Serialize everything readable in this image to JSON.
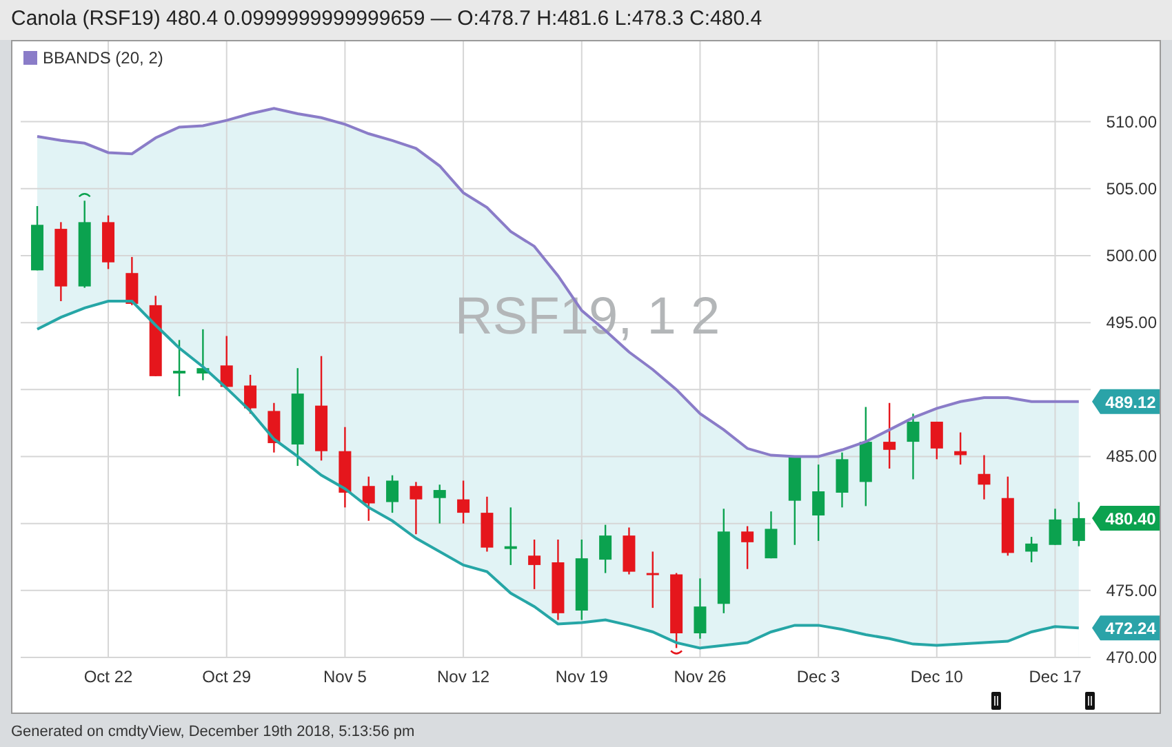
{
  "header": {
    "title": "Canola (RSF19) 480.4 0.0999999999999659 — O:478.7 H:481.6 L:478.3 C:480.4"
  },
  "legend": {
    "color": "#8a7cc8"
  },
  "chart": {
    "symbol_label": "RSF19, 1 2",
    "chart_data": {
      "type": "candlestick",
      "grid": true,
      "ylim": [
        470,
        516
      ],
      "categories": [
        null,
        null,
        null,
        "Oct 22",
        null,
        null,
        null,
        null,
        "Oct 29",
        null,
        null,
        null,
        null,
        "Nov 5",
        null,
        null,
        null,
        null,
        "Nov 12",
        null,
        null,
        null,
        null,
        "Nov 19",
        null,
        null,
        null,
        null,
        "Nov 26",
        null,
        null,
        null,
        null,
        "Dec 3",
        null,
        null,
        null,
        null,
        "Dec 10",
        null,
        null,
        null,
        null,
        "Dec 17",
        null
      ],
      "yticks": [
        {
          "value": 470,
          "label": "470.00"
        },
        {
          "value": 475,
          "label": "475.00"
        },
        {
          "value": 485,
          "label": "485.00"
        },
        {
          "value": 495,
          "label": "495.00"
        },
        {
          "value": 500,
          "label": "500.00"
        },
        {
          "value": 505,
          "label": "505.00"
        },
        {
          "value": 510,
          "label": "510.00"
        }
      ],
      "ohlc": [
        [
          498.9,
          503.7,
          498.9,
          502.3
        ],
        [
          502.0,
          502.5,
          496.6,
          497.7
        ],
        [
          497.7,
          504.1,
          497.6,
          502.5
        ],
        [
          502.5,
          503.0,
          499.0,
          499.5
        ],
        [
          498.7,
          499.9,
          496.3,
          496.4
        ],
        [
          496.3,
          497.0,
          491.0,
          491.0
        ],
        [
          491.2,
          493.7,
          489.5,
          491.4
        ],
        [
          491.2,
          494.5,
          490.7,
          491.6
        ],
        [
          491.8,
          494.0,
          490.0,
          490.2
        ],
        [
          490.3,
          491.1,
          488.2,
          488.6
        ],
        [
          488.4,
          489.0,
          485.3,
          486.0
        ],
        [
          485.9,
          491.6,
          484.3,
          489.7
        ],
        [
          488.8,
          492.5,
          484.7,
          485.4
        ],
        [
          485.4,
          487.2,
          481.2,
          482.3
        ],
        [
          482.8,
          483.5,
          480.2,
          481.5
        ],
        [
          481.6,
          483.6,
          480.8,
          483.2
        ],
        [
          482.8,
          483.1,
          479.2,
          481.8
        ],
        [
          481.9,
          482.9,
          480.0,
          482.5
        ],
        [
          481.8,
          483.2,
          480.0,
          480.8
        ],
        [
          480.8,
          482.0,
          477.9,
          478.2
        ],
        [
          478.1,
          481.2,
          476.9,
          478.3
        ],
        [
          477.6,
          478.8,
          475.1,
          476.9
        ],
        [
          477.1,
          478.8,
          472.8,
          473.3
        ],
        [
          473.5,
          478.8,
          472.8,
          477.4
        ],
        [
          477.3,
          479.9,
          476.3,
          479.1
        ],
        [
          479.1,
          479.7,
          476.2,
          476.4
        ],
        [
          476.3,
          477.9,
          473.7,
          476.2
        ],
        [
          476.2,
          476.3,
          470.7,
          471.8
        ],
        [
          471.8,
          475.9,
          471.4,
          473.8
        ],
        [
          474.0,
          481.1,
          473.3,
          479.4
        ],
        [
          479.4,
          479.8,
          476.6,
          478.6
        ],
        [
          477.4,
          480.9,
          477.4,
          479.6
        ],
        [
          481.7,
          485.0,
          478.4,
          485.0
        ],
        [
          480.6,
          484.4,
          478.7,
          482.4
        ],
        [
          482.3,
          485.3,
          481.2,
          484.8
        ],
        [
          483.1,
          488.7,
          481.3,
          486.1
        ],
        [
          486.1,
          489.0,
          484.1,
          485.5
        ],
        [
          486.1,
          488.2,
          483.3,
          487.6
        ],
        [
          487.6,
          487.6,
          484.8,
          485.6
        ],
        [
          485.4,
          486.8,
          484.4,
          485.1
        ],
        [
          483.7,
          485.1,
          481.8,
          482.9
        ],
        [
          481.9,
          483.5,
          477.6,
          477.8
        ],
        [
          477.9,
          479.0,
          477.1,
          478.5
        ],
        [
          478.4,
          481.1,
          478.4,
          480.3
        ],
        [
          478.7,
          481.6,
          478.3,
          480.4
        ]
      ],
      "series": [
        {
          "name": "BBANDS (20, 2)",
          "type": "area",
          "color": "#8a7cc8",
          "values": [
            508.9,
            508.6,
            508.4,
            507.7,
            507.6,
            508.8,
            509.6,
            509.7,
            510.1,
            510.6,
            511.0,
            510.6,
            510.3,
            509.8,
            509.1,
            508.6,
            508.0,
            506.7,
            504.7,
            503.6,
            501.8,
            500.7,
            498.5,
            495.9,
            494.4,
            492.8,
            491.5,
            490.0,
            488.2,
            487.0,
            485.6,
            485.1,
            485.0,
            485.0,
            485.5,
            486.1,
            487.0,
            487.9,
            488.6,
            489.1,
            489.4,
            489.4,
            489.1,
            489.1,
            489.1
          ]
        },
        {
          "type": "area",
          "color": "#26a6a6",
          "values": [
            494.5,
            495.4,
            496.1,
            496.6,
            496.6,
            494.8,
            493.1,
            491.7,
            490.1,
            488.4,
            486.3,
            485.0,
            483.6,
            482.6,
            481.2,
            480.2,
            478.9,
            477.9,
            476.9,
            476.4,
            474.8,
            473.8,
            472.5,
            472.6,
            472.8,
            472.4,
            471.9,
            471.1,
            470.7,
            470.9,
            471.1,
            471.9,
            472.4,
            472.4,
            472.1,
            471.7,
            471.4,
            471.0,
            470.9,
            471.0,
            471.1,
            471.2,
            471.9,
            472.3,
            472.2
          ]
        }
      ],
      "annotations": [
        "489.12",
        "480.40",
        "472.24"
      ]
    }
  },
  "footer": {
    "text": "Generated on cmdtyView, December 19th 2018, 5:13:56 pm"
  }
}
